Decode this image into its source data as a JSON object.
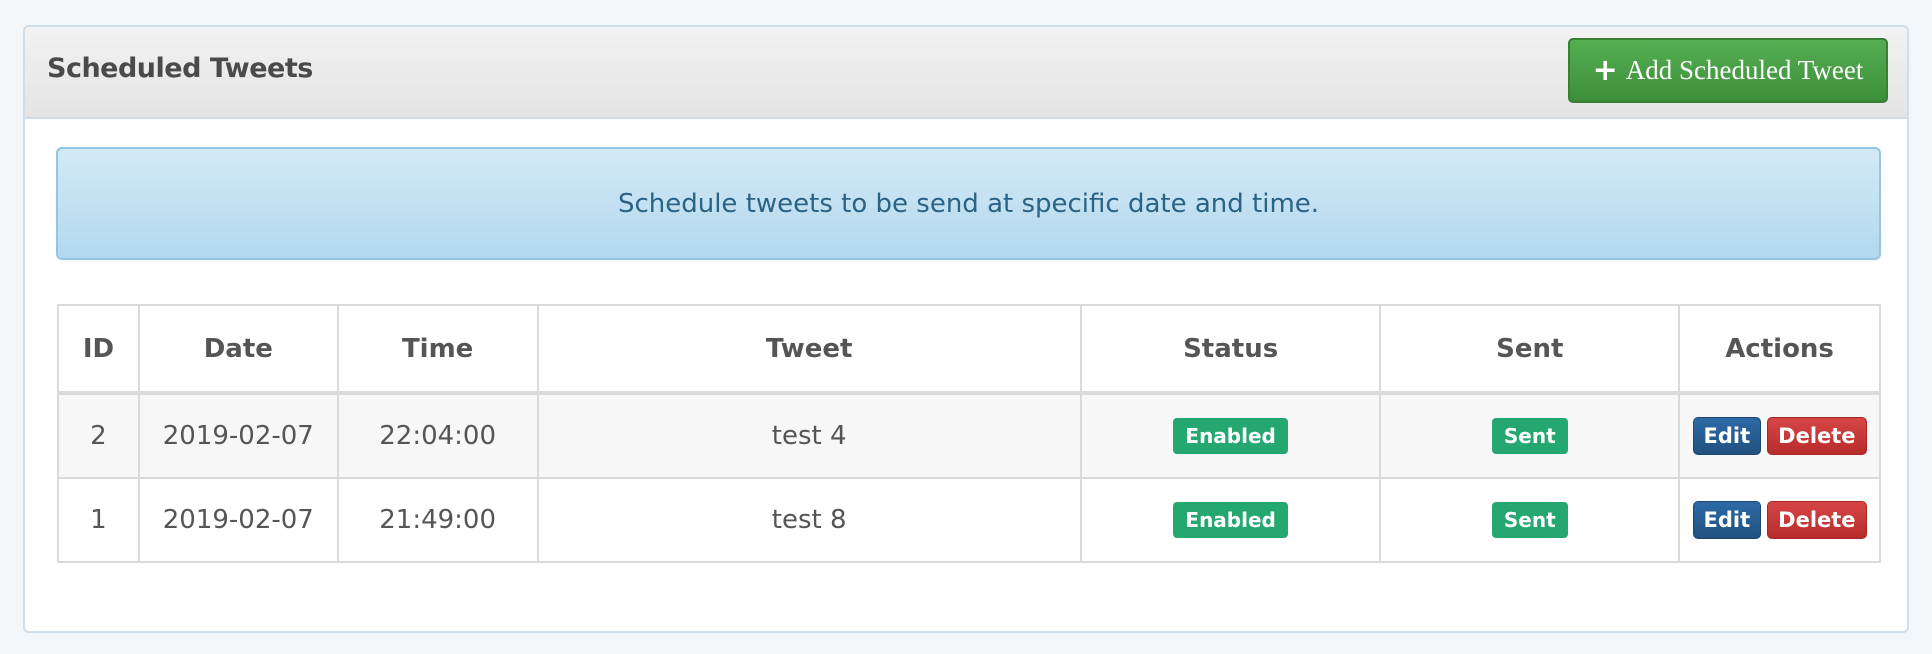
{
  "panel": {
    "title": "Scheduled Tweets",
    "add_button": "Add Scheduled Tweet",
    "add_icon": "plus-icon"
  },
  "alert": {
    "text": "Schedule tweets to be send at specific date and time."
  },
  "table": {
    "headers": [
      "ID",
      "Date",
      "Time",
      "Tweet",
      "Status",
      "Sent",
      "Actions"
    ],
    "rows": [
      {
        "id": "2",
        "date": "2019-02-07",
        "time": "22:04:00",
        "tweet": "test 4",
        "status": "Enabled",
        "sent": "Sent",
        "edit": "Edit",
        "delete": "Delete"
      },
      {
        "id": "1",
        "date": "2019-02-07",
        "time": "21:49:00",
        "tweet": "test 8",
        "status": "Enabled",
        "sent": "Sent",
        "edit": "Edit",
        "delete": "Delete"
      }
    ]
  },
  "colors": {
    "success": "#25a870",
    "primary": "#2d6aa6",
    "danger": "#d64545",
    "add": "#4a9f47"
  }
}
